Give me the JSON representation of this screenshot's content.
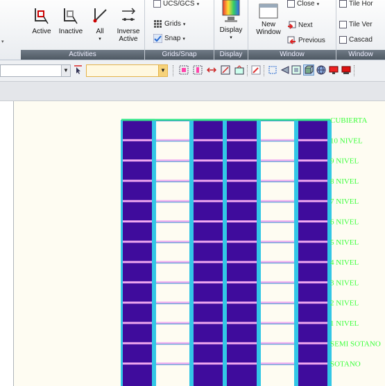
{
  "ribbon": {
    "activities": {
      "title": "Activities",
      "active_label": "Active",
      "inactive_label": "Inactive",
      "all_label": "All",
      "inverse_label_1": "Inverse",
      "inverse_label_2": "Active"
    },
    "gridsnap": {
      "title": "Grids/Snap",
      "ucs_label": "UCS/GCS",
      "grids_label": "Grids",
      "snap_label": "Snap"
    },
    "display": {
      "title": "Display",
      "display_label": "Display"
    },
    "window": {
      "title": "Window",
      "new_window_1": "New",
      "new_window_2": "Window",
      "close_label": "Close",
      "next_label": "Next",
      "previous_label": "Previous"
    },
    "window2": {
      "title": "Window",
      "tile_horizontal": "Tile Hor",
      "tile_vertical": "Tile Ver",
      "cascade": "Cascad"
    }
  },
  "toolbar": {
    "combo1_value": "",
    "combo2_value": ""
  },
  "drawing": {
    "levels": [
      "CUBIERTA",
      "10 NIVEL",
      "9 NIVEL",
      "8 NIVEL",
      "7 NIVEL",
      "6 NIVEL",
      "5 NIVEL",
      "4 NIVEL",
      "3 NIVEL",
      "2 NIVEL",
      "1 NIVEL",
      "SEMI SOTANO",
      "SOTANO"
    ],
    "colors": {
      "wall": "#3f0c9c",
      "column": "#33c7e6",
      "beam": "#f0a8f0",
      "roof": "#35e88a",
      "label": "#3cff3c"
    }
  }
}
